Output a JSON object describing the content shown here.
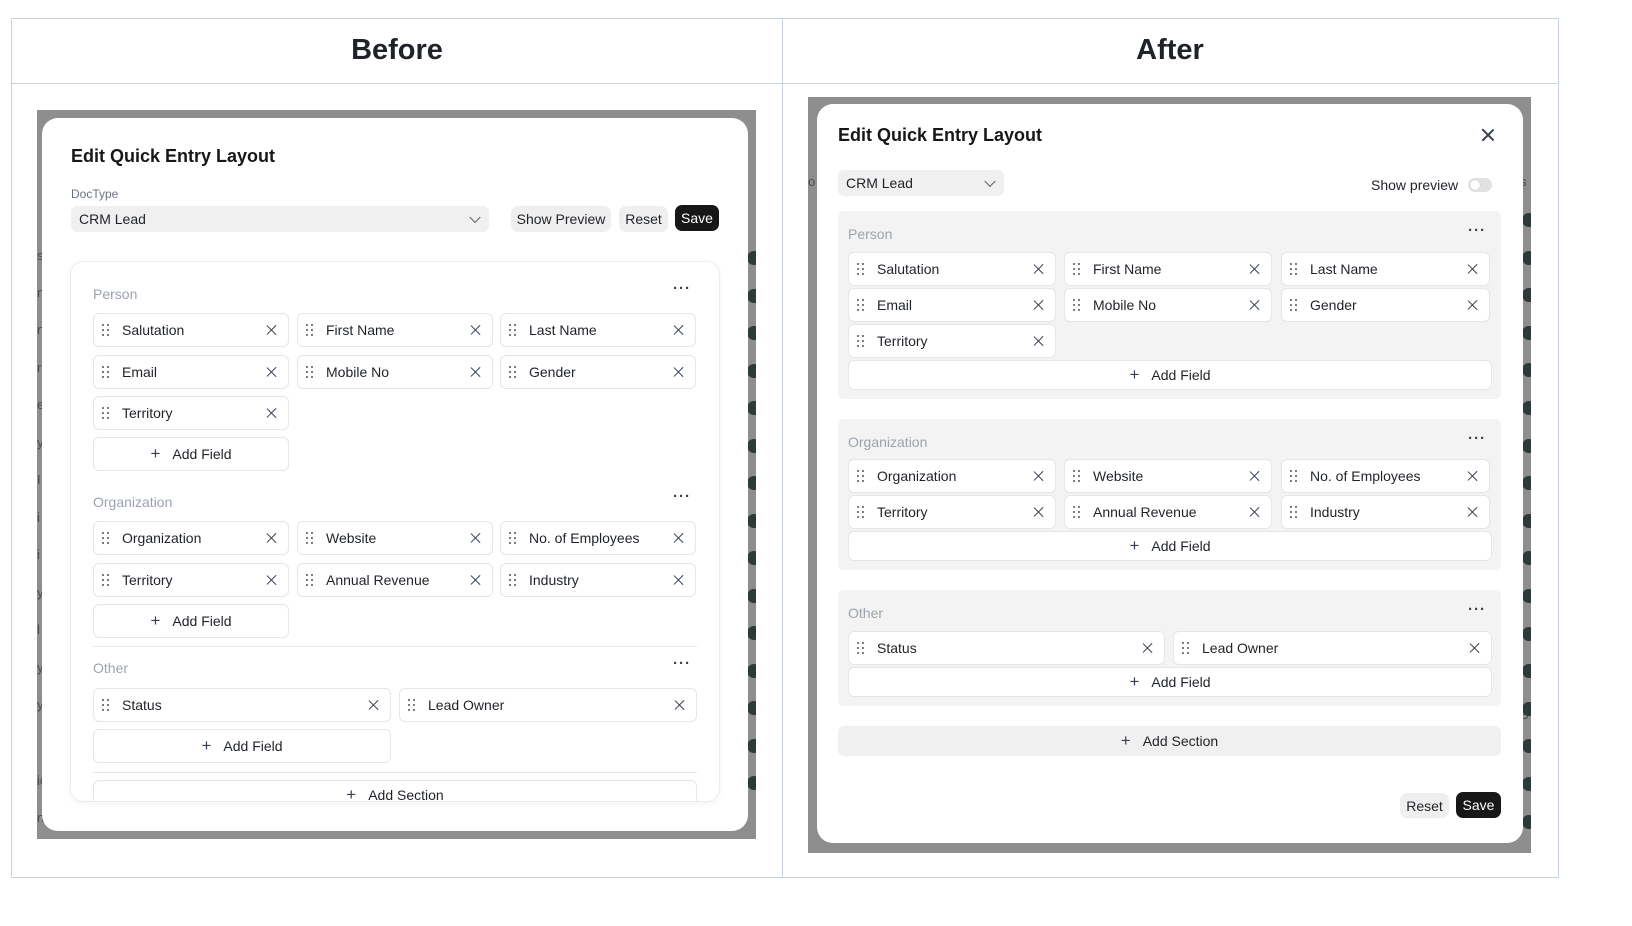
{
  "before": {
    "heading": "Before",
    "title": "Edit Quick Entry Layout",
    "doctype_label": "DocType",
    "doctype_value": "CRM Lead",
    "buttons": {
      "preview": "Show Preview",
      "reset": "Reset",
      "save": "Save"
    },
    "sections": [
      {
        "name": "Person",
        "fields": [
          "Salutation",
          "First Name",
          "Last Name",
          "Email",
          "Mobile No",
          "Gender",
          "Territory"
        ]
      },
      {
        "name": "Organization",
        "fields": [
          "Organization",
          "Website",
          "No. of Employees",
          "Territory",
          "Annual Revenue",
          "Industry"
        ]
      },
      {
        "name": "Other",
        "fields": [
          "Status",
          "Lead Owner"
        ]
      }
    ],
    "add_field": "Add Field",
    "add_section": "Add Section"
  },
  "after": {
    "heading": "After",
    "title": "Edit Quick Entry Layout",
    "doctype_value": "CRM Lead",
    "show_preview": "Show preview",
    "show_preview_on": false,
    "buttons": {
      "reset": "Reset",
      "save": "Save"
    },
    "sections": [
      {
        "name": "Person",
        "fields": [
          "Salutation",
          "First Name",
          "Last Name",
          "Email",
          "Mobile No",
          "Gender",
          "Territory"
        ]
      },
      {
        "name": "Organization",
        "fields": [
          "Organization",
          "Website",
          "No. of Employees",
          "Territory",
          "Annual Revenue",
          "Industry"
        ]
      },
      {
        "name": "Other",
        "fields": [
          "Status",
          "Lead Owner"
        ]
      }
    ],
    "add_field": "Add Field",
    "add_section": "Add Section"
  },
  "backdrop_left": [
    "s",
    "n",
    "n",
    "r",
    "e",
    "y",
    "I",
    "i",
    "i",
    "y",
    "l",
    "y",
    "y",
    "ic",
    "n"
  ],
  "backdrop_right": [
    "J",
    "s",
    "o",
    "S",
    "F",
    "S"
  ],
  "colors": {
    "dark_button": "#171717",
    "backdrop": "#8e8e8e",
    "border": "#c9d3de"
  }
}
